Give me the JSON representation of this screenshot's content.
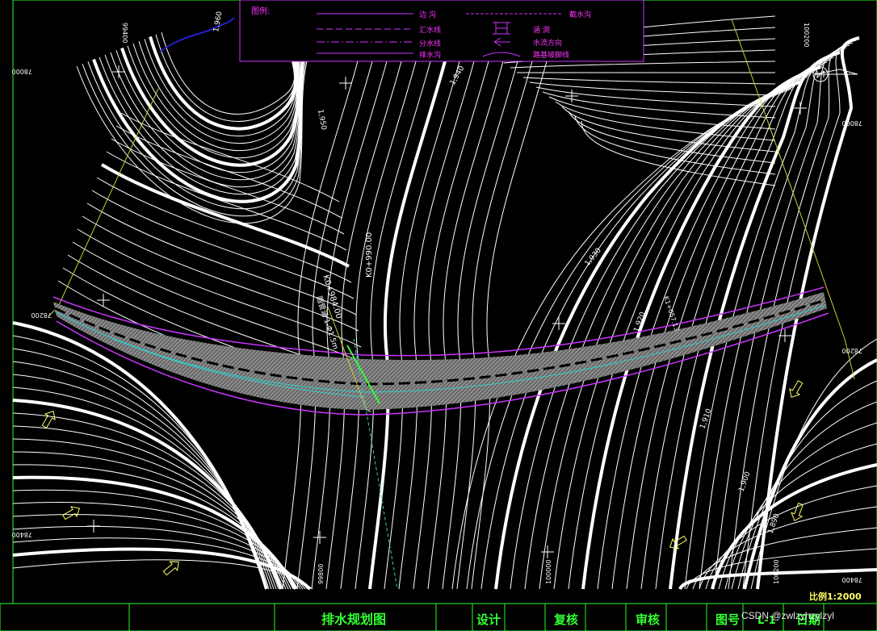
{
  "colors": {
    "background": "#000000",
    "contour": "#ffffff",
    "legend_text": "#ff33ff",
    "frame": "#22ff22",
    "boundary": "#cccc33",
    "ditch": "#cc33ff",
    "centerline": "#33cccc",
    "arrow": "#ffff66"
  },
  "legend": {
    "title": "图例:",
    "items": [
      {
        "label": "边  沟"
      },
      {
        "label": "截水沟"
      },
      {
        "label": "汇水线"
      },
      {
        "label": "涵  洞"
      },
      {
        "label": "分水线"
      },
      {
        "label": "水流方向"
      },
      {
        "label": "排水沟"
      },
      {
        "label": "路基坡脚线"
      }
    ]
  },
  "stations": {
    "culvert": "K0+984.00",
    "section": "K0+990.00",
    "culvert_note": "圆管涵 1-Φ1.5m",
    "right": "K1+057.13"
  },
  "coordinates": {
    "top_left_x": "99400",
    "top_right_x": "100200",
    "left_y": "78000",
    "right_y": "78000",
    "left_mid_y": "78200",
    "right_mid_y": "78200",
    "bottom_left_y": "78400",
    "bottom_right_y": "78400",
    "bottom_x1": "99800",
    "bottom_x2": "100000",
    "bottom_x3": "100200"
  },
  "contours": {
    "elev_a": "1,960",
    "elev_b": "1,950",
    "elev_c": "1,940",
    "elev_d": "1,930",
    "elev_e": "1,920",
    "elev_f": "1,910",
    "elev_g": "1,900",
    "elev_h": "1,890"
  },
  "scale": "比例1:2000",
  "title_block": {
    "drawing_title": "排水规划图",
    "design": "设计",
    "review": "复核",
    "approve": "审核",
    "drawing_no_label": "图号",
    "drawing_no": "L-1",
    "date": "日期"
  },
  "watermark": "CSDN @zwlzyhzylzyl"
}
